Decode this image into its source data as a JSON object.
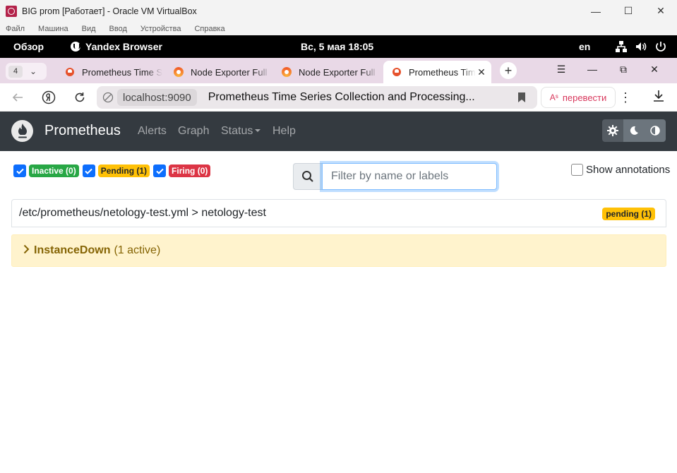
{
  "vbox": {
    "title": "BIG prom [Работает] - Oracle VM VirtualBox",
    "menu": [
      "Файл",
      "Машина",
      "Вид",
      "Ввод",
      "Устройства",
      "Справка"
    ]
  },
  "gnome": {
    "overview": "Обзор",
    "app_name": "Yandex Browser",
    "clock": "Вс, 5 мая  18:05",
    "lang": "en"
  },
  "browser": {
    "tab_count": "4",
    "tabs": [
      {
        "title": "Prometheus Time S",
        "favicon": "prometheus-icon"
      },
      {
        "title": "Node Exporter Full",
        "favicon": "grafana-icon"
      },
      {
        "title": "Node Exporter Full",
        "favicon": "grafana-icon"
      },
      {
        "title": "Prometheus Tim",
        "favicon": "prometheus-icon",
        "active": true
      }
    ],
    "host": "localhost:9090",
    "page_title": "Prometheus Time Series Collection and Processing...",
    "translate_label": "перевести"
  },
  "prom": {
    "brand": "Prometheus",
    "nav": {
      "alerts": "Alerts",
      "graph": "Graph",
      "status": "Status",
      "help": "Help"
    },
    "filters": {
      "inactive": "Inactive (0)",
      "pending": "Pending (1)",
      "firing": "Firing (0)"
    },
    "search_placeholder": "Filter by name or labels",
    "show_annotations": "Show annotations",
    "group": {
      "path": "/etc/prometheus/netology-test.yml > netology-test",
      "badge": "pending (1)"
    },
    "rule": {
      "name": "InstanceDown",
      "count": "(1 active)"
    }
  },
  "colors": {
    "navbar": "#343a40",
    "inactive": "#28a745",
    "pending": "#ffc107",
    "firing": "#dc3545",
    "rule_bg": "#fff3cd",
    "rule_text": "#856404"
  }
}
